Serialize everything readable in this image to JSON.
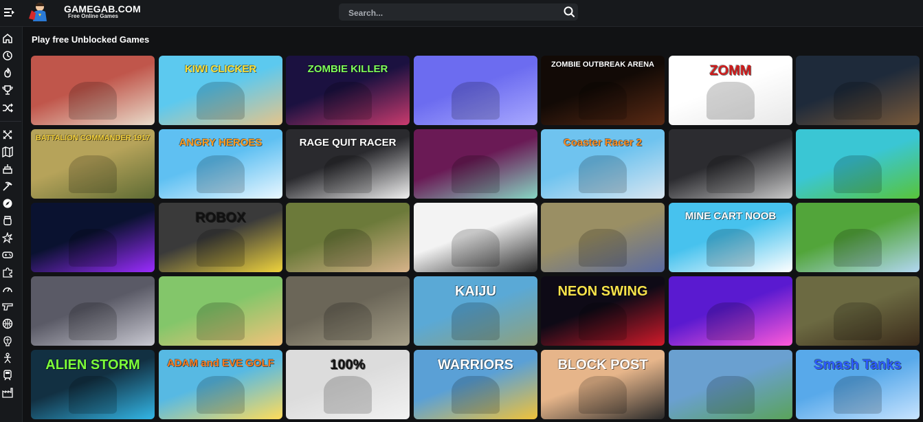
{
  "header": {
    "logo_title": "GAMEGAB.COM",
    "logo_subtitle": "Free Online Games",
    "search_placeholder": "Search..."
  },
  "sidebar": {
    "items": [
      {
        "icon": "home-icon"
      },
      {
        "icon": "history-icon"
      },
      {
        "icon": "fire-icon"
      },
      {
        "icon": "trophy-icon"
      },
      {
        "icon": "shuffle-icon"
      },
      {
        "icon": "swords-icon"
      },
      {
        "icon": "map-icon"
      },
      {
        "icon": "cake-icon"
      },
      {
        "icon": "pickaxe-icon"
      },
      {
        "icon": "compass-icon"
      },
      {
        "icon": "jar-icon"
      },
      {
        "icon": "explosion-icon"
      },
      {
        "icon": "gamepad-icon"
      },
      {
        "icon": "puzzle-icon"
      },
      {
        "icon": "speedometer-icon"
      },
      {
        "icon": "gun-icon"
      },
      {
        "icon": "basketball-icon"
      },
      {
        "icon": "brain-icon"
      },
      {
        "icon": "stickman-icon"
      },
      {
        "icon": "train-icon"
      },
      {
        "icon": "factory-icon"
      }
    ]
  },
  "main": {
    "title": "Play free Unblocked Games",
    "games": [
      {
        "label": "",
        "bg": "#c0564b",
        "bg2": "#e9dccb",
        "fg": "#ffffff"
      },
      {
        "label": "KIWI CLICKER",
        "bg": "#5cc9ef",
        "bg2": "#e5c48a",
        "fg": "#ffe035"
      },
      {
        "label": "ZOMBIE KILLER",
        "bg": "#1b1140",
        "bg2": "#c93b6e",
        "fg": "#7fff5a"
      },
      {
        "label": "",
        "bg": "#6c6cf0",
        "bg2": "#a9a9ff",
        "fg": "#ffffff"
      },
      {
        "label": "ZOMBIE OUTBREAK ARENA",
        "bg": "#120a06",
        "bg2": "#5a2a14",
        "fg": "#ffffff"
      },
      {
        "label": "ZOMM",
        "bg": "#ffffff",
        "bg2": "#e8e8e8",
        "fg": "#d11a1a"
      },
      {
        "label": "",
        "bg": "#1e2a3a",
        "bg2": "#7a5a3a",
        "fg": "#ffffff"
      },
      {
        "label": "BATTALION COMMANDER 1917",
        "bg": "#b6a35a",
        "bg2": "#5e6b34",
        "fg": "#f6d23c"
      },
      {
        "label": "ANGRY HEROES",
        "bg": "#5fc0f2",
        "bg2": "#eaf7ff",
        "fg": "#ff9a1e"
      },
      {
        "label": "RAGE QUIT RACER",
        "bg": "#2a2a2e",
        "bg2": "#f0f0f0",
        "fg": "#ffffff"
      },
      {
        "label": "",
        "bg": "#6a1a55",
        "bg2": "#88d6c4",
        "fg": "#ffffff"
      },
      {
        "label": "Coaster Racer 2",
        "bg": "#6fc3ef",
        "bg2": "#d9e6f0",
        "fg": "#ff8a1a"
      },
      {
        "label": "",
        "bg": "#2c2c30",
        "bg2": "#c8c8c8",
        "fg": "#ffffff"
      },
      {
        "label": "",
        "bg": "#3ac6d4",
        "bg2": "#58c43a",
        "fg": "#ffffff"
      },
      {
        "label": "",
        "bg": "#0a1230",
        "bg2": "#9b2cff",
        "fg": "#ffffff"
      },
      {
        "label": "ROBOX",
        "bg": "#3a3a3a",
        "bg2": "#efd33c",
        "fg": "#111111"
      },
      {
        "label": "",
        "bg": "#6c7a3a",
        "bg2": "#d7b38a",
        "fg": "#ffffff"
      },
      {
        "label": "",
        "bg": "#f3f3f3",
        "bg2": "#2a2a2a",
        "fg": "#111111"
      },
      {
        "label": "",
        "bg": "#9a8f64",
        "bg2": "#5a6aa0",
        "fg": "#ffffff"
      },
      {
        "label": "MINE CART NOOB",
        "bg": "#47c2ee",
        "bg2": "#ffffff",
        "fg": "#ffffff"
      },
      {
        "label": "",
        "bg": "#52a53a",
        "bg2": "#b2d7f2",
        "fg": "#ffffff"
      },
      {
        "label": "",
        "bg": "#5a5a66",
        "bg2": "#c9c9d2",
        "fg": "#ffffff"
      },
      {
        "label": "",
        "bg": "#83c66a",
        "bg2": "#f3c27a",
        "fg": "#ffffff"
      },
      {
        "label": "",
        "bg": "#6b6658",
        "bg2": "#a8a18a",
        "fg": "#ffffff"
      },
      {
        "label": "KAIJU",
        "bg": "#5aa9d6",
        "bg2": "#8fa07a",
        "fg": "#ffffff"
      },
      {
        "label": "NEON SWING",
        "bg": "#0e0a16",
        "bg2": "#d11a2a",
        "fg": "#f6e24a"
      },
      {
        "label": "",
        "bg": "#5a1ad0",
        "bg2": "#ff5ad9",
        "fg": "#ffffff"
      },
      {
        "label": "",
        "bg": "#6c6a42",
        "bg2": "#3a2a1a",
        "fg": "#ffffff"
      },
      {
        "label": "ALIEN STORM",
        "bg": "#123042",
        "bg2": "#33b6e6",
        "fg": "#7dff3a"
      },
      {
        "label": "ADAM and EVE GOLF",
        "bg": "#57b9e3",
        "bg2": "#ffdc5a",
        "fg": "#ff7a1a"
      },
      {
        "label": "100%",
        "bg": "#dcdcdc",
        "bg2": "#f2f2f2",
        "fg": "#111111"
      },
      {
        "label": "WARRIORS",
        "bg": "#5aa0d6",
        "bg2": "#f0c23a",
        "fg": "#ffffff"
      },
      {
        "label": "BLOCK POST",
        "bg": "#e6b58a",
        "bg2": "#2a2a2a",
        "fg": "#ffffff"
      },
      {
        "label": "",
        "bg": "#6aa0d0",
        "bg2": "#5aa35a",
        "fg": "#ffffff"
      },
      {
        "label": "Smash Tanks",
        "bg": "#58a9ea",
        "bg2": "#c8e4ff",
        "fg": "#2c5aff"
      }
    ]
  },
  "colors": {
    "background": "#111214",
    "bar": "#17191c",
    "search_bg": "#24272b"
  }
}
